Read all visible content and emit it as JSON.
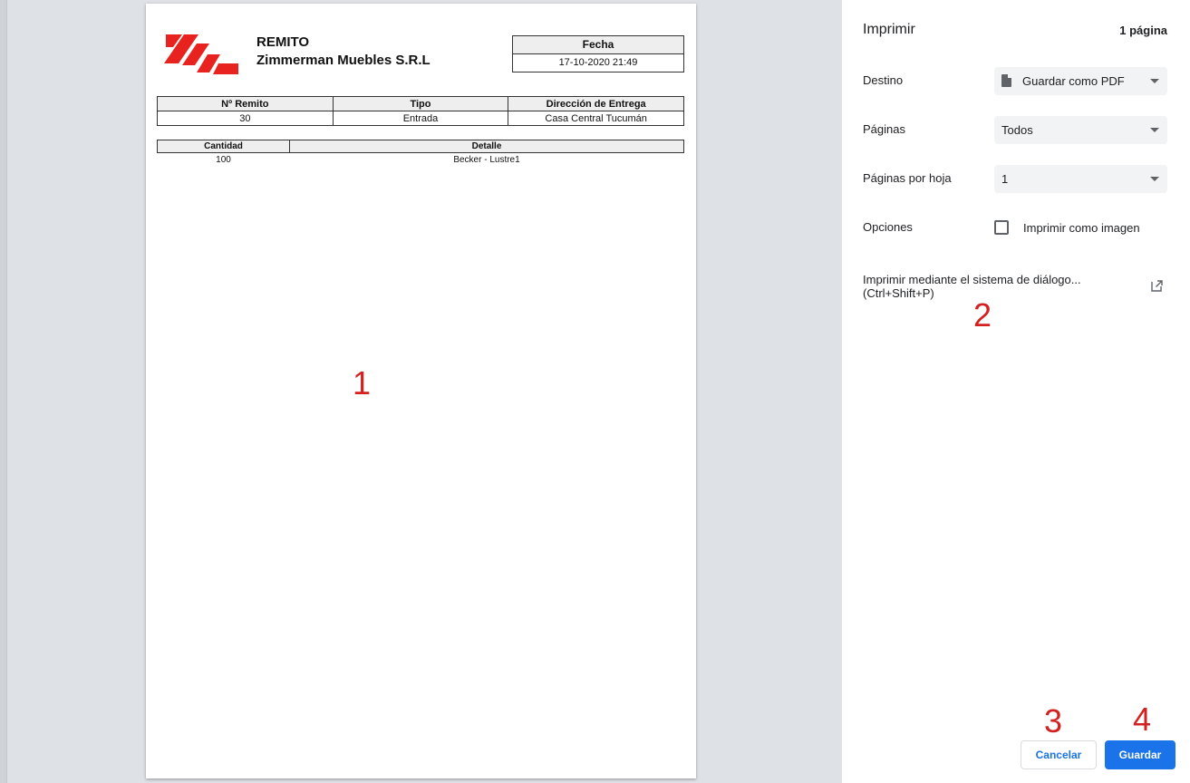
{
  "document": {
    "title": "REMITO",
    "company": "Zimmerman Muebles S.R.L",
    "fecha_label": "Fecha",
    "fecha_value": "17-10-2020 21:49",
    "info_headers": [
      "Nº Remito",
      "Tipo",
      "Dirección de Entrega"
    ],
    "info_values": [
      "30",
      "Entrada",
      "Casa Central Tucumán"
    ],
    "detail_headers": [
      "Cantidad",
      "Detalle"
    ],
    "detail_rows": [
      [
        "100",
        "Becker - Lustre1"
      ]
    ]
  },
  "annotations": [
    "1",
    "2",
    "3",
    "4"
  ],
  "panel": {
    "title": "Imprimir",
    "page_count": "1 página",
    "destino_label": "Destino",
    "destino_value": "Guardar como PDF",
    "paginas_label": "Páginas",
    "paginas_value": "Todos",
    "por_hoja_label": "Páginas por hoja",
    "por_hoja_value": "1",
    "opciones_label": "Opciones",
    "imagen_label": "Imprimir como imagen",
    "system_dialog_line1": "Imprimir mediante el sistema de diálogo...",
    "system_dialog_line2": "(Ctrl+Shift+P)",
    "cancel_label": "Cancelar",
    "save_label": "Guardar"
  },
  "colors": {
    "accent": "#1a73e8",
    "annotation": "#d32020",
    "logo": "#e8231f"
  }
}
